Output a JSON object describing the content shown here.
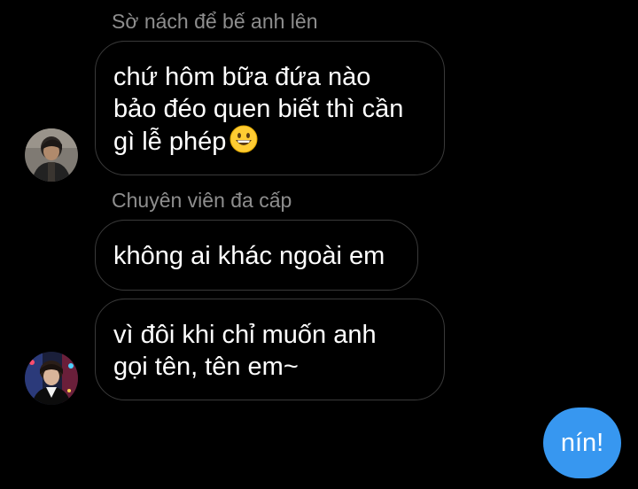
{
  "messages": {
    "group1": {
      "sender": "Sờ nách để bế anh lên",
      "lines": [
        "chứ hôm bữa đứa nào",
        "bảo đéo quen biết thì cần",
        "gì lễ phép"
      ],
      "emoji": "grinning-face-emoji"
    },
    "group2": {
      "sender": "Chuyên viên đa cấp",
      "bubble1": [
        "không ai khác ngoài em"
      ],
      "bubble2": [
        "vì đôi khi chỉ muốn anh",
        "gọi tên, tên em~"
      ]
    },
    "sent": {
      "text": "nín!"
    }
  },
  "colors": {
    "background": "#000000",
    "bubble_border": "#3a3a3a",
    "sender_name": "#8e8e8e",
    "sent_bubble": "#3797f0",
    "text": "#ffffff"
  }
}
